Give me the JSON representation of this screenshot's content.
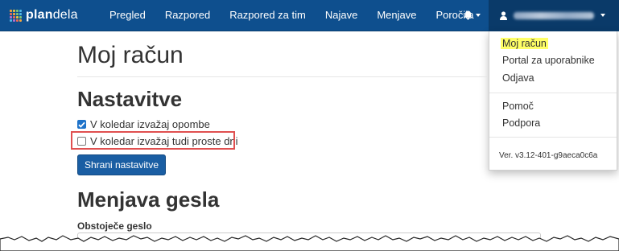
{
  "brand": {
    "name_bold": "plan",
    "name_regular": "dela",
    "grid_colors": [
      "#f4a63b",
      "#e8c23f",
      "#7cc576",
      "#4fb7e6",
      "#e96a54",
      "#f4a63b",
      "#7cc576",
      "#4fb7e6",
      "#b56fd1",
      "#e96a54",
      "#e8c23f",
      "#7cc576",
      "#4fb7e6",
      "#b56fd1",
      "#e96a54",
      "#f4a63b"
    ]
  },
  "nav": {
    "items": [
      {
        "label": "Pregled"
      },
      {
        "label": "Razpored"
      },
      {
        "label": "Razpored za tim"
      },
      {
        "label": "Najave"
      },
      {
        "label": "Menjave"
      },
      {
        "label": "Poročila"
      }
    ],
    "notification_icon": "bell-icon",
    "user_icon": "user-icon"
  },
  "user_menu": {
    "items": [
      {
        "label": "Moj račun"
      },
      {
        "label": "Portal za uporabnike"
      },
      {
        "label": "Odjava"
      },
      {
        "label": "Pomoč"
      },
      {
        "label": "Podpora"
      }
    ],
    "version": "Ver. v3.12-401-g9aeca0c6a"
  },
  "page": {
    "title": "Moj račun",
    "settings": {
      "heading": "Nastavitve",
      "options": [
        {
          "label": "V koledar izvažaj opombe",
          "checked": true
        },
        {
          "label": "V koledar izvažaj tudi proste dni",
          "checked": false
        }
      ],
      "save_label": "Shrani nastavitve"
    },
    "password": {
      "heading": "Menjava gesla",
      "current_label": "Obstoječe geslo"
    }
  },
  "colors": {
    "navbar": "#0e4f8e",
    "highlight": "#ffff66",
    "annotation_box": "#e05050",
    "primary_button": "#1a5ea3",
    "checkbox_checked": "#1f73c9"
  }
}
